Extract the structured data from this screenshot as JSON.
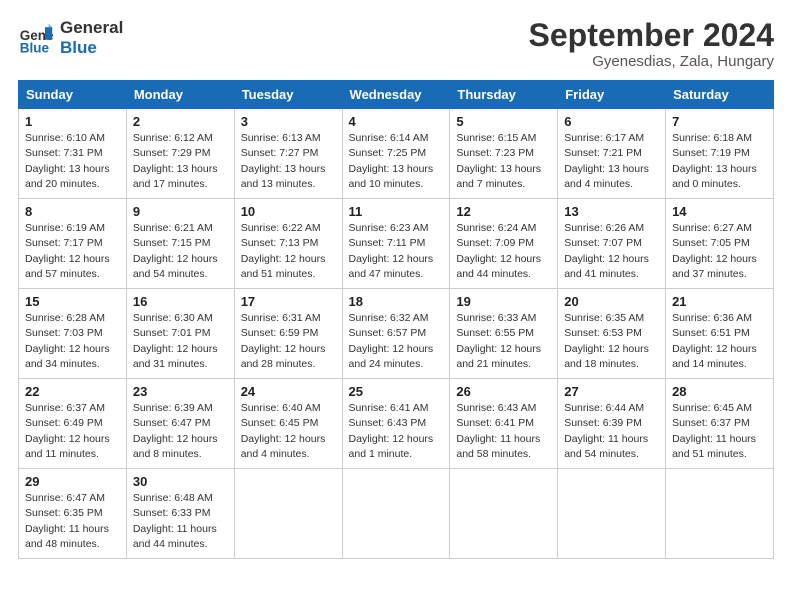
{
  "header": {
    "logo_general": "General",
    "logo_blue": "Blue",
    "month": "September 2024",
    "location": "Gyenesdias, Zala, Hungary"
  },
  "weekdays": [
    "Sunday",
    "Monday",
    "Tuesday",
    "Wednesday",
    "Thursday",
    "Friday",
    "Saturday"
  ],
  "weeks": [
    [
      {
        "day": "1",
        "sunrise": "Sunrise: 6:10 AM",
        "sunset": "Sunset: 7:31 PM",
        "daylight": "Daylight: 13 hours and 20 minutes."
      },
      {
        "day": "2",
        "sunrise": "Sunrise: 6:12 AM",
        "sunset": "Sunset: 7:29 PM",
        "daylight": "Daylight: 13 hours and 17 minutes."
      },
      {
        "day": "3",
        "sunrise": "Sunrise: 6:13 AM",
        "sunset": "Sunset: 7:27 PM",
        "daylight": "Daylight: 13 hours and 13 minutes."
      },
      {
        "day": "4",
        "sunrise": "Sunrise: 6:14 AM",
        "sunset": "Sunset: 7:25 PM",
        "daylight": "Daylight: 13 hours and 10 minutes."
      },
      {
        "day": "5",
        "sunrise": "Sunrise: 6:15 AM",
        "sunset": "Sunset: 7:23 PM",
        "daylight": "Daylight: 13 hours and 7 minutes."
      },
      {
        "day": "6",
        "sunrise": "Sunrise: 6:17 AM",
        "sunset": "Sunset: 7:21 PM",
        "daylight": "Daylight: 13 hours and 4 minutes."
      },
      {
        "day": "7",
        "sunrise": "Sunrise: 6:18 AM",
        "sunset": "Sunset: 7:19 PM",
        "daylight": "Daylight: 13 hours and 0 minutes."
      }
    ],
    [
      {
        "day": "8",
        "sunrise": "Sunrise: 6:19 AM",
        "sunset": "Sunset: 7:17 PM",
        "daylight": "Daylight: 12 hours and 57 minutes."
      },
      {
        "day": "9",
        "sunrise": "Sunrise: 6:21 AM",
        "sunset": "Sunset: 7:15 PM",
        "daylight": "Daylight: 12 hours and 54 minutes."
      },
      {
        "day": "10",
        "sunrise": "Sunrise: 6:22 AM",
        "sunset": "Sunset: 7:13 PM",
        "daylight": "Daylight: 12 hours and 51 minutes."
      },
      {
        "day": "11",
        "sunrise": "Sunrise: 6:23 AM",
        "sunset": "Sunset: 7:11 PM",
        "daylight": "Daylight: 12 hours and 47 minutes."
      },
      {
        "day": "12",
        "sunrise": "Sunrise: 6:24 AM",
        "sunset": "Sunset: 7:09 PM",
        "daylight": "Daylight: 12 hours and 44 minutes."
      },
      {
        "day": "13",
        "sunrise": "Sunrise: 6:26 AM",
        "sunset": "Sunset: 7:07 PM",
        "daylight": "Daylight: 12 hours and 41 minutes."
      },
      {
        "day": "14",
        "sunrise": "Sunrise: 6:27 AM",
        "sunset": "Sunset: 7:05 PM",
        "daylight": "Daylight: 12 hours and 37 minutes."
      }
    ],
    [
      {
        "day": "15",
        "sunrise": "Sunrise: 6:28 AM",
        "sunset": "Sunset: 7:03 PM",
        "daylight": "Daylight: 12 hours and 34 minutes."
      },
      {
        "day": "16",
        "sunrise": "Sunrise: 6:30 AM",
        "sunset": "Sunset: 7:01 PM",
        "daylight": "Daylight: 12 hours and 31 minutes."
      },
      {
        "day": "17",
        "sunrise": "Sunrise: 6:31 AM",
        "sunset": "Sunset: 6:59 PM",
        "daylight": "Daylight: 12 hours and 28 minutes."
      },
      {
        "day": "18",
        "sunrise": "Sunrise: 6:32 AM",
        "sunset": "Sunset: 6:57 PM",
        "daylight": "Daylight: 12 hours and 24 minutes."
      },
      {
        "day": "19",
        "sunrise": "Sunrise: 6:33 AM",
        "sunset": "Sunset: 6:55 PM",
        "daylight": "Daylight: 12 hours and 21 minutes."
      },
      {
        "day": "20",
        "sunrise": "Sunrise: 6:35 AM",
        "sunset": "Sunset: 6:53 PM",
        "daylight": "Daylight: 12 hours and 18 minutes."
      },
      {
        "day": "21",
        "sunrise": "Sunrise: 6:36 AM",
        "sunset": "Sunset: 6:51 PM",
        "daylight": "Daylight: 12 hours and 14 minutes."
      }
    ],
    [
      {
        "day": "22",
        "sunrise": "Sunrise: 6:37 AM",
        "sunset": "Sunset: 6:49 PM",
        "daylight": "Daylight: 12 hours and 11 minutes."
      },
      {
        "day": "23",
        "sunrise": "Sunrise: 6:39 AM",
        "sunset": "Sunset: 6:47 PM",
        "daylight": "Daylight: 12 hours and 8 minutes."
      },
      {
        "day": "24",
        "sunrise": "Sunrise: 6:40 AM",
        "sunset": "Sunset: 6:45 PM",
        "daylight": "Daylight: 12 hours and 4 minutes."
      },
      {
        "day": "25",
        "sunrise": "Sunrise: 6:41 AM",
        "sunset": "Sunset: 6:43 PM",
        "daylight": "Daylight: 12 hours and 1 minute."
      },
      {
        "day": "26",
        "sunrise": "Sunrise: 6:43 AM",
        "sunset": "Sunset: 6:41 PM",
        "daylight": "Daylight: 11 hours and 58 minutes."
      },
      {
        "day": "27",
        "sunrise": "Sunrise: 6:44 AM",
        "sunset": "Sunset: 6:39 PM",
        "daylight": "Daylight: 11 hours and 54 minutes."
      },
      {
        "day": "28",
        "sunrise": "Sunrise: 6:45 AM",
        "sunset": "Sunset: 6:37 PM",
        "daylight": "Daylight: 11 hours and 51 minutes."
      }
    ],
    [
      {
        "day": "29",
        "sunrise": "Sunrise: 6:47 AM",
        "sunset": "Sunset: 6:35 PM",
        "daylight": "Daylight: 11 hours and 48 minutes."
      },
      {
        "day": "30",
        "sunrise": "Sunrise: 6:48 AM",
        "sunset": "Sunset: 6:33 PM",
        "daylight": "Daylight: 11 hours and 44 minutes."
      },
      null,
      null,
      null,
      null,
      null
    ]
  ]
}
